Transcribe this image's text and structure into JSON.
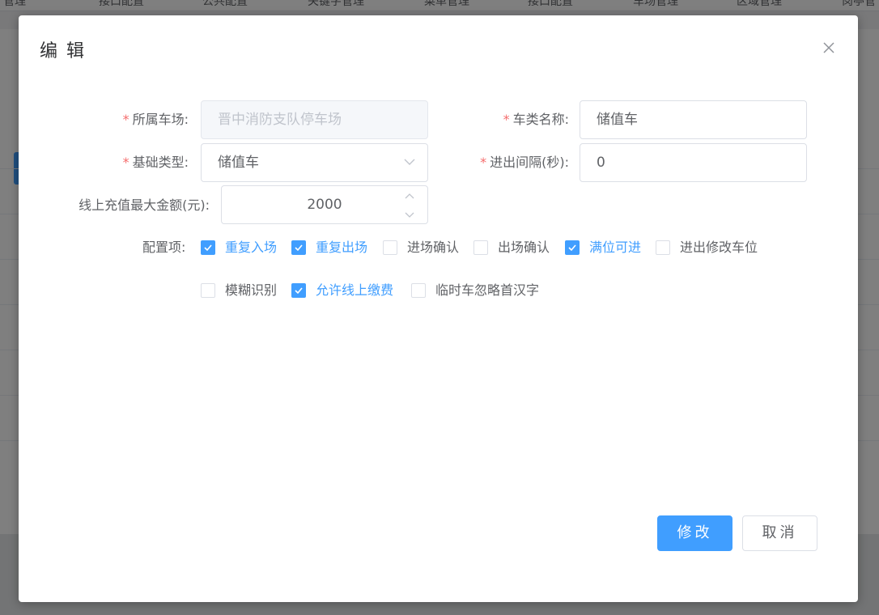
{
  "background": {
    "nav_items": [
      "管理",
      "接口配置",
      "公共配置",
      "关键字管理",
      "菜单管理",
      "接口配置",
      "车场管理",
      "区域管理",
      "岗亭管"
    ]
  },
  "dialog": {
    "title": "编 辑",
    "close_icon": "close-icon",
    "fields": {
      "parking_lot": {
        "label": "所属车场:",
        "value": "晋中消防支队停车场",
        "required": true
      },
      "car_type_name": {
        "label": "车类名称:",
        "value": "储值车",
        "required": true
      },
      "base_type": {
        "label": "基础类型:",
        "value": "储值车",
        "required": true
      },
      "in_out_interval": {
        "label": "进出间隔(秒):",
        "value": "0",
        "required": true
      },
      "max_recharge": {
        "label": "线上充值最大金额(元):",
        "value": "2000",
        "required": false
      }
    },
    "options_label": "配置项:",
    "options": [
      {
        "label": "重复入场",
        "checked": true
      },
      {
        "label": "重复出场",
        "checked": true
      },
      {
        "label": "进场确认",
        "checked": false
      },
      {
        "label": "出场确认",
        "checked": false
      },
      {
        "label": "满位可进",
        "checked": true
      },
      {
        "label": "进出修改车位",
        "checked": false
      },
      {
        "label": "模糊识别",
        "checked": false
      },
      {
        "label": "允许线上缴费",
        "checked": true
      },
      {
        "label": "临时车忽略首汉字",
        "checked": false
      }
    ],
    "buttons": {
      "confirm": "修改",
      "cancel": "取消"
    },
    "colors": {
      "primary": "#409eff",
      "required": "#f56c6c"
    }
  }
}
